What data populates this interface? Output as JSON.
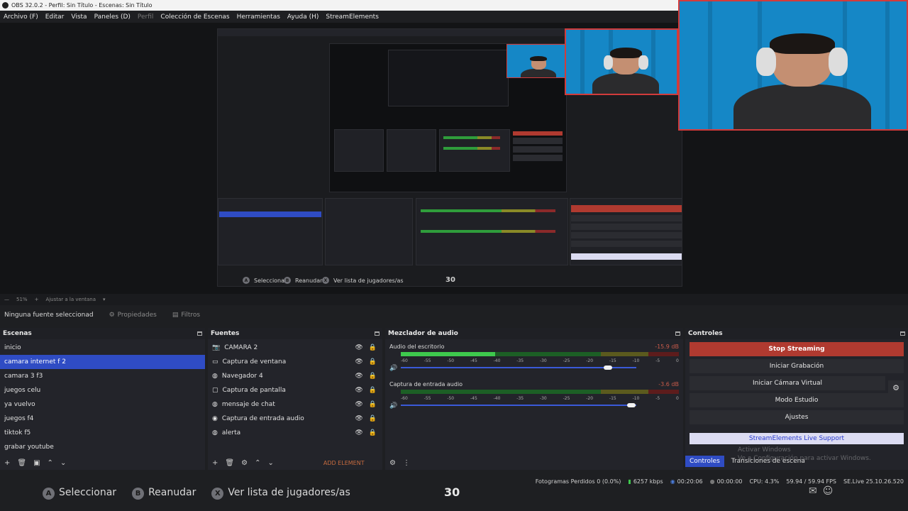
{
  "window": {
    "title": "OBS 32.0.2 - Perfil: Sin Título - Escenas: Sin Título"
  },
  "menu": [
    {
      "label": "Archivo (F)",
      "dim": false
    },
    {
      "label": "Editar",
      "dim": false
    },
    {
      "label": "Vista",
      "dim": false
    },
    {
      "label": "Paneles (D)",
      "dim": false
    },
    {
      "label": "Perfil",
      "dim": true
    },
    {
      "label": "Colección de Escenas",
      "dim": false
    },
    {
      "label": "Herramientas",
      "dim": false
    },
    {
      "label": "Ayuda (H)",
      "dim": false
    },
    {
      "label": "StreamElements",
      "dim": false
    }
  ],
  "preview_overlay": {
    "select": "Seleccionar",
    "resume": "Reanudar",
    "players": "Ver lista de jugadores/as",
    "count": "30",
    "btn_a": "A",
    "btn_b": "B",
    "btn_x": "X"
  },
  "zoom": {
    "percent": "51%",
    "fit": "Ajustar a la ventana"
  },
  "source_bar": {
    "no_source": "Ninguna fuente seleccionad",
    "properties": "Propiedades",
    "filters": "Filtros"
  },
  "scenes": {
    "title": "Escenas",
    "items": [
      "inicio",
      "camara internet f 2",
      "camara 3 f3",
      "juegos celu",
      "ya vuelvo",
      "juegos f4",
      "tiktok f5",
      "grabar youtube"
    ],
    "selected_index": 1
  },
  "sources": {
    "title": "Fuentes",
    "items": [
      {
        "label": "CAMARA 2",
        "icon": "camera-icon"
      },
      {
        "label": "Captura de ventana",
        "icon": "window-icon"
      },
      {
        "label": "Navegador 4",
        "icon": "globe-icon"
      },
      {
        "label": "Captura de pantalla",
        "icon": "monitor-icon"
      },
      {
        "label": "mensaje de chat",
        "icon": "globe-icon"
      },
      {
        "label": "Captura de entrada audio",
        "icon": "mic-icon"
      },
      {
        "label": "alerta",
        "icon": "globe-icon"
      }
    ],
    "add_element": "ADD ELEMENT"
  },
  "mixer": {
    "title": "Mezclador de audio",
    "ticks": [
      "-60",
      "-55",
      "-50",
      "-45",
      "-40",
      "-35",
      "-30",
      "-25",
      "-20",
      "-15",
      "-10",
      "-5",
      "0"
    ],
    "channels": [
      {
        "name": "Audio del escritorio",
        "db": "-15.9 dB",
        "level": 0.34,
        "volume": 0.88
      },
      {
        "name": "Captura de entrada audio",
        "db": "-3.6 dB",
        "level": 0.0,
        "volume": 0.98
      }
    ]
  },
  "controls": {
    "title": "Controles",
    "stop_streaming": "Stop Streaming",
    "start_recording": "Iniciar Grabación",
    "virtual_camera": "Iniciar Cámara Virtual",
    "studio_mode": "Modo Estudio",
    "settings": "Ajustes",
    "live_support": "StreamElements Live Support",
    "tab_controls": "Controles",
    "tab_transitions": "Transiciones de escena"
  },
  "watermark": {
    "line1": "Activar Windows",
    "line2": "Ve a Configuración para activar Windows."
  },
  "status": {
    "frames_dropped": "Fotogramas Perdidos 0 (0.0%)",
    "bitrate": "6257 kbps",
    "stream_time": "00:20:06",
    "rec_time": "00:00:00",
    "cpu": "CPU: 4.3%",
    "fps": "59.94 / 59.94 FPS",
    "version": "SE.Live 25.10.26.520"
  },
  "colors": {
    "accent": "#2f4cc4",
    "stop": "#b03a30",
    "cam_border": "#d23b3b"
  }
}
